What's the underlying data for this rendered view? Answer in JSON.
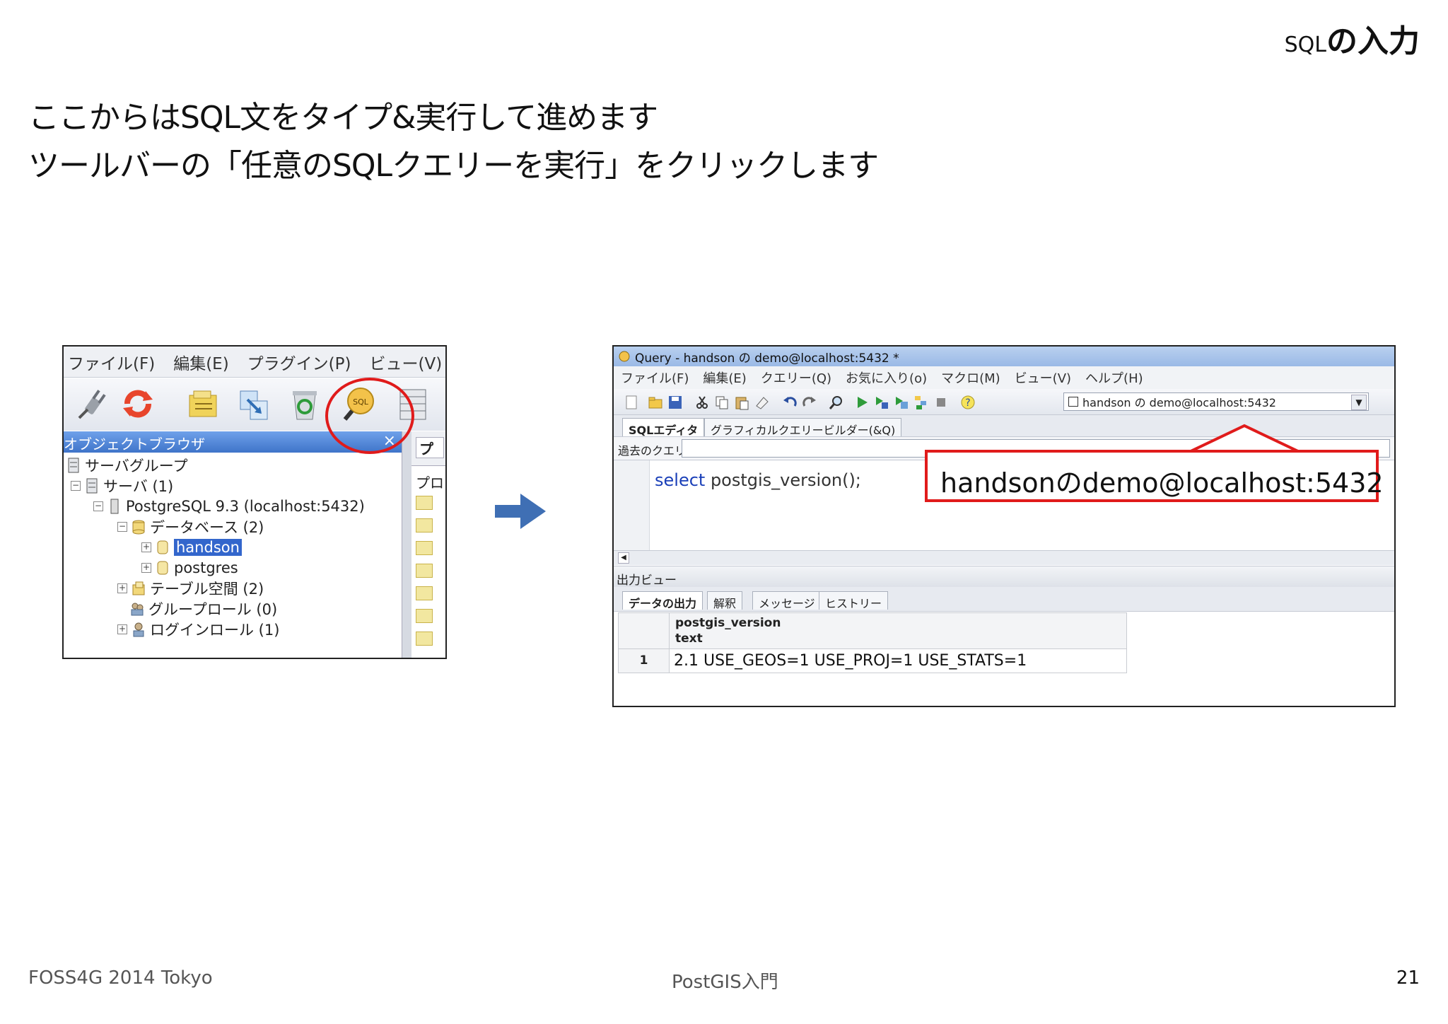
{
  "slide": {
    "title_prefix": "SQL",
    "title_suffix": "の入力",
    "intro_line1": "ここからはSQL文をタイプ&実行して進めます",
    "intro_line2": "ツールバーの「任意のSQLクエリーを実行」をクリックします",
    "footer_left": "FOSS4G 2014 Tokyo",
    "footer_center": "PostGIS入門",
    "page_number": "21"
  },
  "left_window": {
    "menu": [
      "ファイル(F)",
      "編集(E)",
      "プラグイン(P)",
      "ビュー(V)"
    ],
    "toolbar_icons": [
      "plug-icon",
      "refresh-icon",
      "properties-icon",
      "create-object-icon",
      "delete-icon",
      "sql-query-icon",
      "view-data-icon"
    ],
    "object_browser_title": "オブジェクトブラウザ",
    "tree": [
      {
        "label": "サーバグループ"
      },
      {
        "label": "サーバ (1)"
      },
      {
        "label": "PostgreSQL 9.3 (localhost:5432)"
      },
      {
        "label": "データベース (2)"
      },
      {
        "label": "handson",
        "selected": true
      },
      {
        "label": "postgres"
      },
      {
        "label": "テーブル空間 (2)"
      },
      {
        "label": "グループロール (0)"
      },
      {
        "label": "ログインロール (1)"
      }
    ],
    "right_pane_tab": "プ",
    "right_pane_label": "プロ"
  },
  "right_window": {
    "title": "Query - handson の demo@localhost:5432 *",
    "menu": [
      "ファイル(F)",
      "編集(E)",
      "クエリー(Q)",
      "お気に入り(o)",
      "マクロ(M)",
      "ビュー(V)",
      "ヘルプ(H)"
    ],
    "connection_value": "handson の demo@localhost:5432",
    "editor_tabs": [
      "SQLエディタ",
      "グラフィカルクエリービルダー(&Q)"
    ],
    "past_query_label": "過去のクエリ",
    "sql_keyword": "select",
    "sql_rest": " postgis_version();",
    "output_pane_title": "出力ビュー",
    "output_tabs": [
      "データの出力",
      "解釈",
      "メッセージ",
      "ヒストリー"
    ],
    "grid": {
      "column_name": "postgis_version",
      "column_type": "text",
      "row_number": "1",
      "row_value": "2.1 USE_GEOS=1 USE_PROJ=1 USE_STATS=1"
    }
  },
  "callout": {
    "text": "handsonのdemo@localhost:5432",
    "color": "#e01b1b"
  },
  "colors": {
    "highlight_red": "#e01b1b",
    "arrow_blue": "#3f6fb4",
    "selection_blue": "#3366cc"
  }
}
